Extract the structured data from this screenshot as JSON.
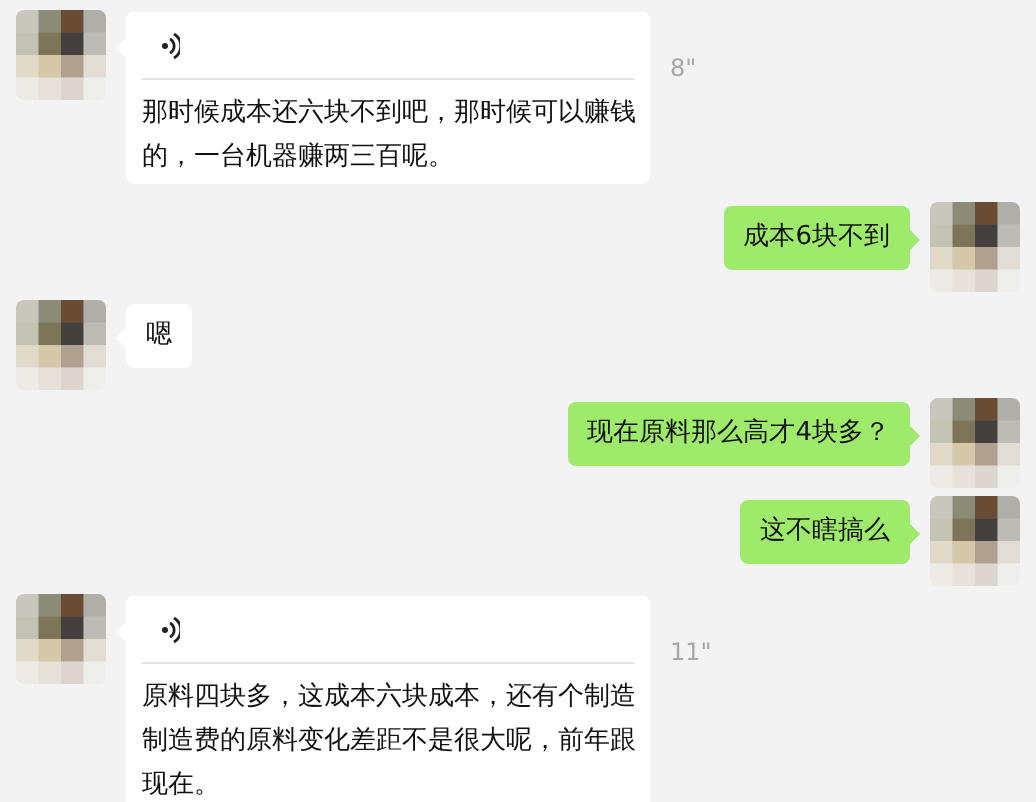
{
  "messages": [
    {
      "sent": false,
      "kind": "voice",
      "duration": "8\"",
      "text": "那时候成本还六块不到吧，那时候可以赚钱的，一台机器赚两三百呢。"
    },
    {
      "sent": true,
      "kind": "text",
      "text": "成本6块不到"
    },
    {
      "sent": false,
      "kind": "text",
      "text": "嗯"
    },
    {
      "sent": true,
      "kind": "text",
      "text": "现在原料那么高才4块多？"
    },
    {
      "sent": true,
      "kind": "text",
      "text": "这不瞎搞么"
    },
    {
      "sent": false,
      "kind": "voice",
      "duration": "11\"",
      "text": "原料四块多，这成本六块成本，还有个制造制造费的原料变化差距不是很大呢，前年跟现在。"
    }
  ]
}
